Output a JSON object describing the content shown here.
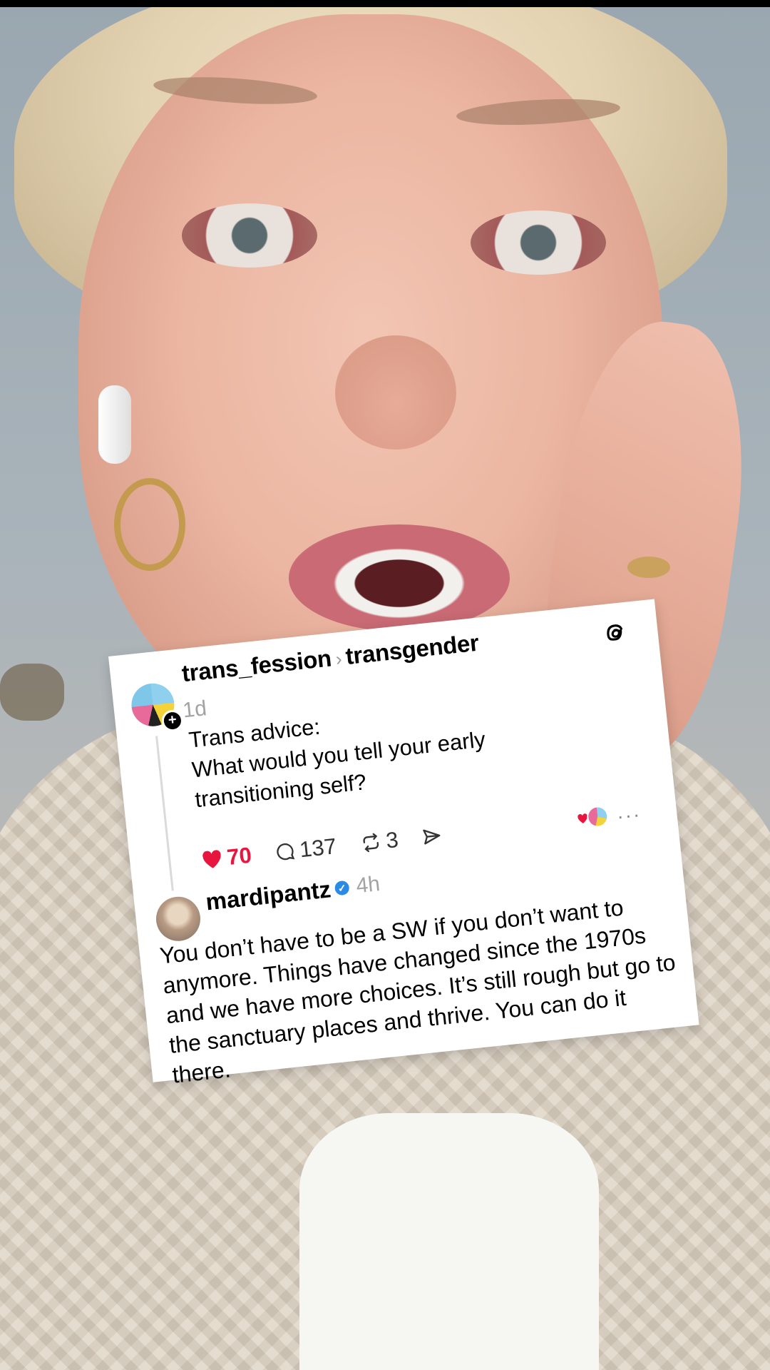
{
  "post": {
    "author": "trans_fession",
    "separator": "›",
    "community": "transgender",
    "time": "1d",
    "text": "Trans advice:\nWhat would you tell your early transitioning self?",
    "likes": "70",
    "replies": "137",
    "reposts": "3",
    "more": "···"
  },
  "reply": {
    "author": "mardipantz",
    "time": "4h",
    "text": "You don’t have to be a SW if you don’t want to anymore. Things have changed since the 1970s and we have more choices. It’s still rough but go to the sanctuary places and thrive. You can do it there."
  },
  "icons": {
    "logo": "threads-logo-icon",
    "like": "heart-icon",
    "comment": "comment-icon",
    "repost": "repost-icon",
    "share": "share-icon",
    "verified": "verified-badge-icon",
    "follow": "plus-icon"
  },
  "colors": {
    "like": "#e8163f",
    "verified": "#2a8ae5",
    "muted": "#a3a3a3",
    "card": "#ffffff"
  }
}
